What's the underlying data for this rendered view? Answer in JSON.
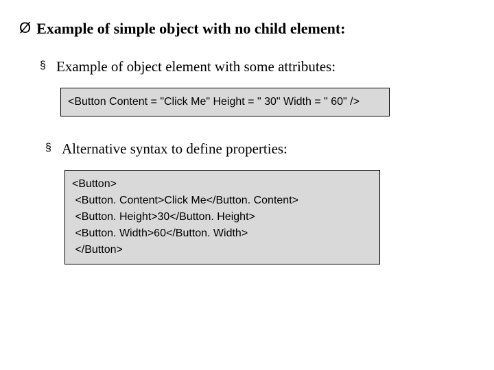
{
  "heading": {
    "bullet": "Ø",
    "text": "Example of simple object with no child element:"
  },
  "sub1": {
    "bullet": "§",
    "text": "Example of object element with some attributes:"
  },
  "code1": "<Button Content = \"Click Me\" Height = \" 30\" Width = \" 60\" />",
  "sub2": {
    "bullet": "§",
    "text": "Alternative syntax to define properties:"
  },
  "code2": "<Button>\n <Button. Content>Click Me</Button. Content>\n <Button. Height>30</Button. Height>\n <Button. Width>60</Button. Width>\n </Button>"
}
